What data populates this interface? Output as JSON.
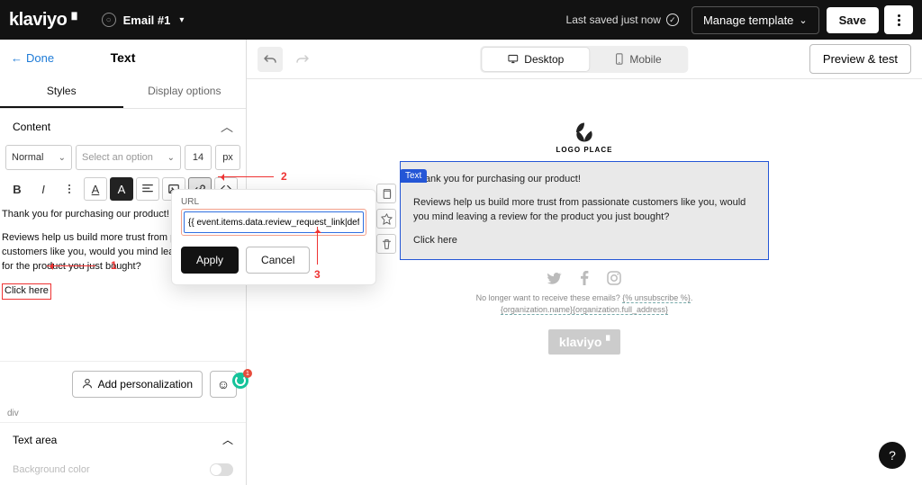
{
  "top": {
    "logo": "klaviyo",
    "email_title": "Email #1",
    "last_saved": "Last saved just now",
    "manage": "Manage template",
    "save": "Save"
  },
  "left": {
    "done": "Done",
    "title": "Text",
    "tabs": {
      "styles": "Styles",
      "display": "Display options"
    },
    "content_section": "Content",
    "format": "Normal",
    "select_ph": "Select an option",
    "fontsize": "14",
    "fontunit": "px",
    "p1": "Thank you for purchasing our product!",
    "p2": "Reviews help us build more trust from passionate customers like you, would you mind leaving a review for the product you just bought?",
    "click_here": "Click here",
    "add_pers": "Add personalization",
    "div": "div",
    "text_area": "Text area",
    "bg_color": "Background color"
  },
  "popover": {
    "label": "URL",
    "value": "{{ event.items.data.review_request_link|defa",
    "apply": "Apply",
    "cancel": "Cancel"
  },
  "annotations": {
    "a1": "1",
    "a2": "2",
    "a3": "3"
  },
  "right": {
    "desktop": "Desktop",
    "mobile": "Mobile",
    "preview": "Preview & test"
  },
  "email": {
    "logo_place": "LOGO PLACE",
    "text_label": "Text",
    "p1": "Thank you for purchasing our product!",
    "p2": "Reviews help us build more trust from passionate customers like you, would you mind leaving a review for the product you just bought?",
    "p3": "Click here",
    "footer1": "No longer want to receive these emails?",
    "unsub": "{% unsubscribe %}",
    "org": "{organization.name}{organization.full_address}",
    "klav": "klaviyo"
  },
  "grammarly_count": "1",
  "help": "?"
}
